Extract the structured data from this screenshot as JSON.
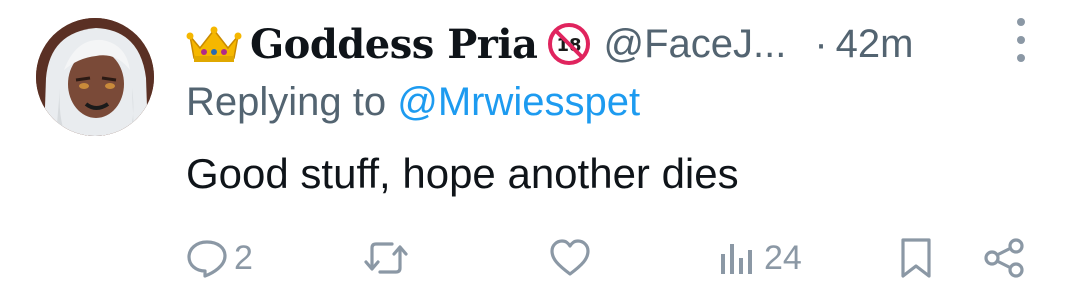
{
  "author": {
    "display_name": "Goddess Pria",
    "handle": "@FaceJ...",
    "separator": "·",
    "time": "42m",
    "emoji_prefix": "crown-icon",
    "badge": "no-under-18-icon"
  },
  "reply": {
    "prefix": "Replying to",
    "username": "@Mrwiesspet"
  },
  "tweet": {
    "text": "Good stuff, hope another dies"
  },
  "actions": {
    "reply_count": "2",
    "retweet_count": "",
    "like_count": "",
    "views_count": "24"
  },
  "colors": {
    "text": "#0f1419",
    "secondary": "#536471",
    "link": "#1d9bf0",
    "icon": "#8b98a5",
    "badge_red": "#e0245e"
  }
}
